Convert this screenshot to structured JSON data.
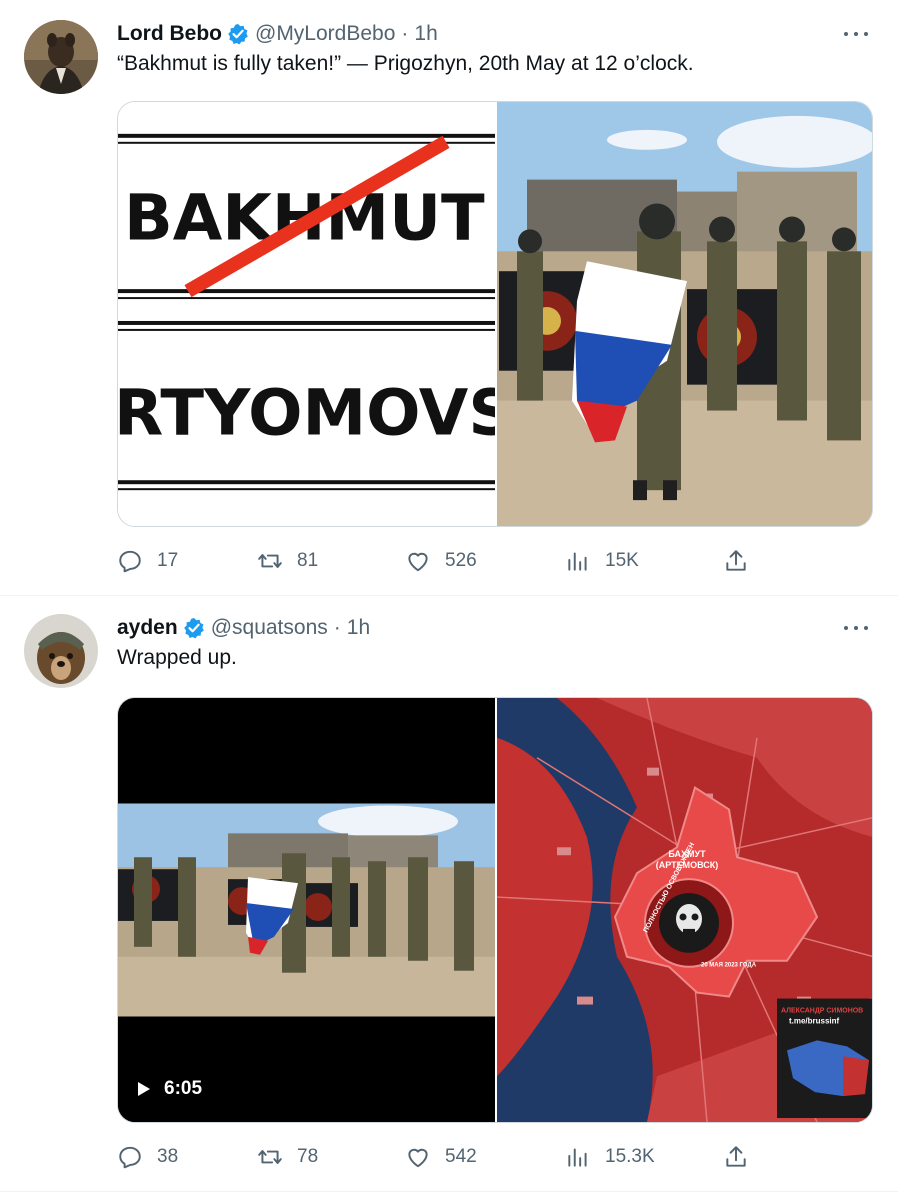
{
  "colors": {
    "verified": "#1d9bf0",
    "muted": "#536471",
    "text": "#0f1419",
    "divider": "#eff3f4"
  },
  "tweets": [
    {
      "name": "Lord Bebo",
      "handle": "@MyLordBebo",
      "separator": "·",
      "time": "1h",
      "text": "“Bakhmut is fully taken!” — Prigozhyn, 20th May at 12 o’clock.",
      "media": {
        "sign_top": "BAKHMUT",
        "sign_bottom": "RTYOMOVS"
      },
      "stats": {
        "replies": "17",
        "retweets": "81",
        "likes": "526",
        "views": "15K"
      }
    },
    {
      "name": "ayden",
      "handle": "@squatsons",
      "separator": "·",
      "time": "1h",
      "text": "Wrapped up.",
      "media": {
        "video_duration": "6:05",
        "map_city": "БАХМУТ",
        "map_city_alt": "(АРТЕМОВСК)",
        "map_banner": "ПОЛНОСТЬЮ ОСВОБОЖДЕН",
        "map_date": "20 МАЯ 2023 ГОДА",
        "map_credit": "АЛЕКСАНДР СИМОНОВ",
        "map_link": "t.me/brussinf"
      },
      "stats": {
        "replies": "38",
        "retweets": "78",
        "likes": "542",
        "views": "15.3K"
      }
    }
  ],
  "icons": [
    "more-icon",
    "verified-badge-icon",
    "reply-icon",
    "retweet-icon",
    "like-icon",
    "views-icon",
    "share-icon",
    "play-icon"
  ]
}
